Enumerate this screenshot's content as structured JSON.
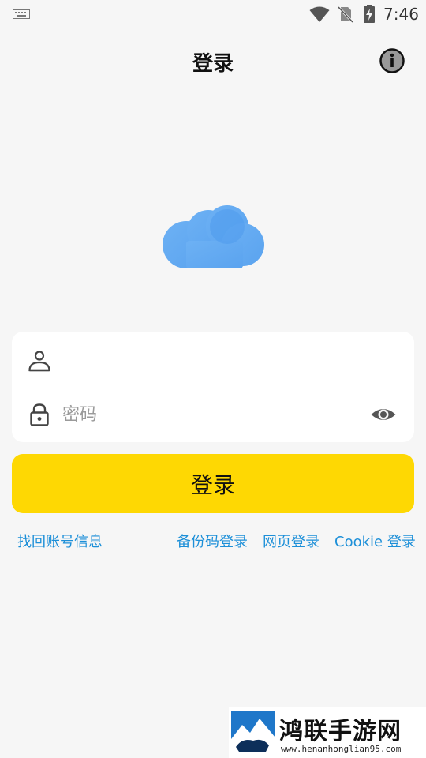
{
  "status_bar": {
    "time": "7:46",
    "icons": [
      "keyboard-icon",
      "wifi-icon",
      "no-sim-icon",
      "battery-charging-icon"
    ]
  },
  "app_bar": {
    "title": "登录",
    "info_icon": "info-icon"
  },
  "logo": {
    "icon": "cloud-icon",
    "colors": [
      "#5aa6f2",
      "#7fbcf7"
    ]
  },
  "form": {
    "username": {
      "icon": "user-icon",
      "value": "",
      "placeholder": ""
    },
    "password": {
      "icon": "lock-icon",
      "value": "",
      "placeholder": "密码",
      "toggle_icon": "eye-icon"
    }
  },
  "login_button": {
    "label": "登录",
    "color": "#fed803"
  },
  "links": {
    "find_account": "找回账号信息",
    "backup_code": "备份码登录",
    "web_login": "网页登录",
    "cookie_login": "Cookie 登录",
    "color": "#1c8fd8"
  },
  "watermark": {
    "title": "鸿联手游网",
    "url": "www.henanhonglian95.com"
  }
}
